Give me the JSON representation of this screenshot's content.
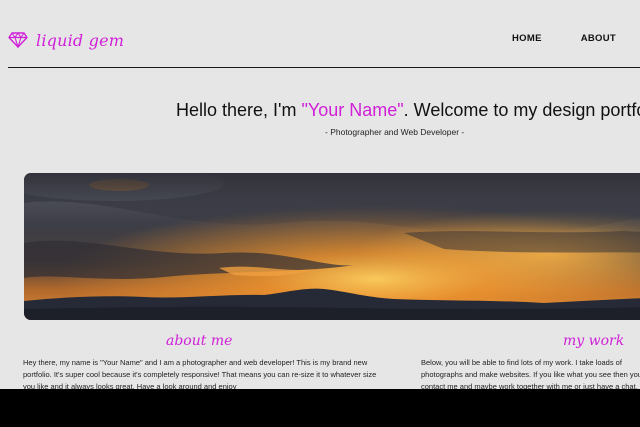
{
  "header": {
    "logo_text": "liquid gem",
    "nav": {
      "home_label": "HOME",
      "about_label": "ABOUT"
    }
  },
  "hero": {
    "title_prefix": "Hello there, I'm ",
    "title_name": "\"Your Name\"",
    "title_suffix": ". Welcome to my design portfolio!",
    "subtitle": "- Photographer and Web Developer -"
  },
  "sections": {
    "about": {
      "title": "about me",
      "body": "Hey there, my name is \"Your Name\" and I am a photographer and web developer! This is my brand new portfolio. It's super cool because it's completely responsive! That means you can re-size it to whatever size you like and it always looks great. Have a look around and enjoy"
    },
    "work": {
      "title": "my work",
      "body": "Below, you will be able to find lots of my work. I take loads of photographs and make websites. If you like what you see then you can contact me and maybe work together with me or just have a chat, either way, I look forward to hearing"
    }
  },
  "colors": {
    "accent": "#d020d8",
    "background": "#e6e6e6"
  },
  "icons": {
    "logo": "diamond-icon"
  }
}
